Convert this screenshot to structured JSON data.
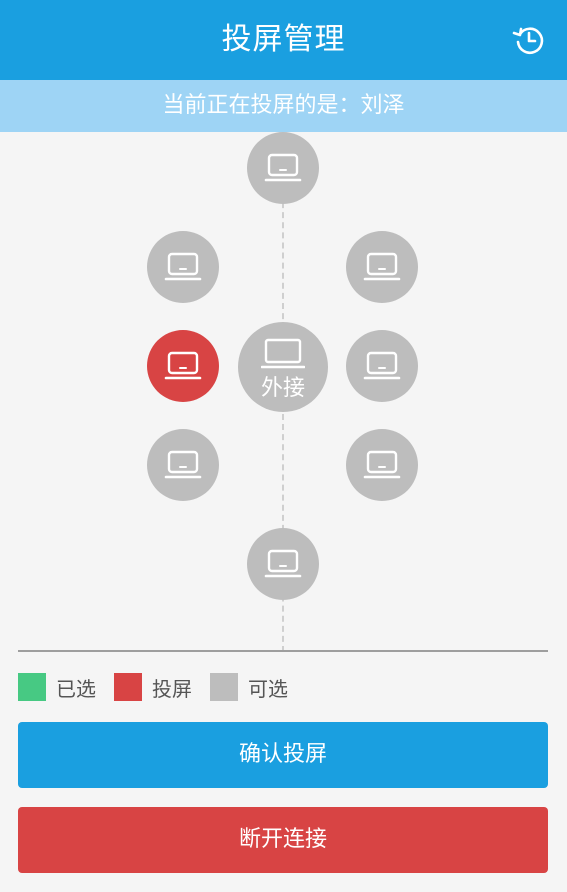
{
  "header": {
    "title": "投屏管理",
    "history_icon": "history-clock-icon"
  },
  "status": {
    "label": "当前正在投屏的是：",
    "name": "刘泽"
  },
  "seats": [
    {
      "id": "top",
      "state": "available"
    },
    {
      "id": "upper-left",
      "state": "available"
    },
    {
      "id": "upper-right",
      "state": "available"
    },
    {
      "id": "middle-left",
      "state": "projecting"
    },
    {
      "id": "middle-right",
      "state": "available"
    },
    {
      "id": "lower-left",
      "state": "available"
    },
    {
      "id": "lower-right",
      "state": "available"
    },
    {
      "id": "bottom",
      "state": "available"
    }
  ],
  "main_device": {
    "label": "外接",
    "icon": "laptop-icon"
  },
  "legend": [
    {
      "label": "已选",
      "color": "#47c983"
    },
    {
      "label": "投屏",
      "color": "#d84444"
    },
    {
      "label": "可选",
      "color": "#bdbdbd"
    }
  ],
  "buttons": {
    "confirm": "确认投屏",
    "disconnect": "断开连接"
  },
  "colors": {
    "primary": "#1a9fe0",
    "subbar": "#9ed4f5",
    "danger": "#d84444",
    "available": "#bdbdbd",
    "selected": "#47c983"
  }
}
